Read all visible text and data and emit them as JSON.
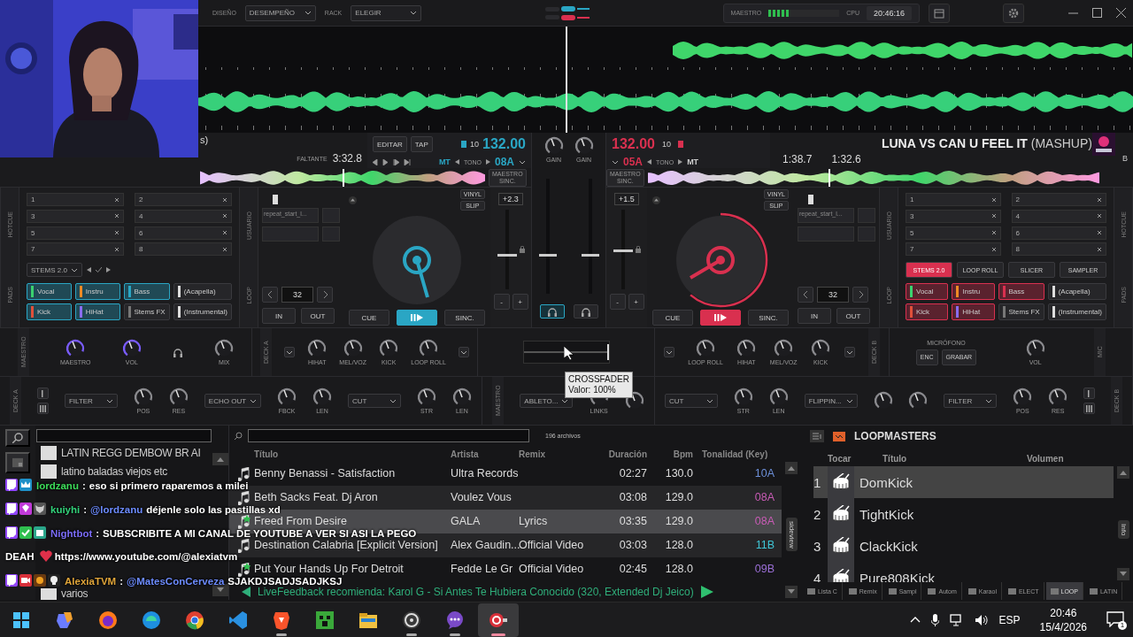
{
  "topbar": {
    "design_label": "DISEÑO",
    "design_value": "DESEMPEÑO",
    "rack_label": "RACK",
    "rack_value": "ELEGIR",
    "master_label": "MAESTRO",
    "master_meter": {
      "level": 0.3
    },
    "cpu_label": "CPU",
    "clock": "20:46:16"
  },
  "decks": [
    {
      "kind": "left",
      "color": "#2aa6c4",
      "title": "s)",
      "remaining_label": "FALTANTE",
      "remaining": "3:32.8",
      "edit": "EDITAR",
      "tap": "TAP",
      "range": "10",
      "bpm": "132.00",
      "mt": "MT",
      "tono": "TONO",
      "key": "08A",
      "sync_master": "MAESTRO",
      "sync_small": "SINC.",
      "outer_labels": [
        "HOTCUE",
        "PADS"
      ],
      "inner_labels": [
        "USUARIO",
        "LOOP"
      ],
      "hotcues": [
        "1",
        "2",
        "3",
        "4",
        "5",
        "6",
        "7",
        "8"
      ],
      "pad_page": {
        "kind": "dropdown",
        "label": "STEMS 2.0"
      },
      "pads": [
        {
          "label": "Vocal",
          "active": true,
          "color": "#3bd16f"
        },
        {
          "label": "Instru",
          "active": true,
          "color": "#f08a24"
        },
        {
          "label": "Bass",
          "active": true,
          "color": "#2aa6c4"
        },
        {
          "label": "(Acapella)",
          "active": false,
          "color": "#dddddd"
        },
        {
          "label": "Kick",
          "active": true,
          "color": "#e0503a"
        },
        {
          "label": "HiHat",
          "active": true,
          "color": "#8a6cf0"
        },
        {
          "label": "Stems FX",
          "active": false,
          "color": "#777777"
        },
        {
          "label": "(Instrumental)",
          "active": false,
          "color": "#dddddd"
        }
      ],
      "sampler_slot": "repeat_start_l...",
      "loop_length": "32",
      "loop_in": "IN",
      "loop_out": "OUT",
      "vinyl": "VINYL",
      "slip": "SLIP",
      "cue": "CUE",
      "sync": "SINC.",
      "playing": true,
      "pitch": "+2.3",
      "pitch_slider": {
        "level": 0.45
      },
      "minus": "-",
      "plus": "+"
    },
    {
      "kind": "right",
      "color": "#d9304f",
      "letter": "B",
      "title": "**LUNA VS CAN U FEEL IT** (MASHUP)",
      "elapsed": "1:38.7",
      "remaining": "1:32.6",
      "range": "10",
      "bpm": "132.00",
      "mt": "MT",
      "tono": "TONO",
      "key": "05A",
      "sync_master": "MAESTRO",
      "sync_small": "SINC.",
      "outer_labels": [
        "HOTCUE",
        "PADS"
      ],
      "inner_labels": [
        "USUARIO",
        "LOOP"
      ],
      "hotcues": [
        "1",
        "2",
        "3",
        "4",
        "5",
        "6",
        "7",
        "8"
      ],
      "pad_page": {
        "kind": "tabs",
        "tabs": [
          {
            "label": "STEMS 2.0",
            "selected": true
          },
          {
            "label": "LOOP ROLL",
            "selected": false
          },
          {
            "label": "SLICER",
            "selected": false
          },
          {
            "label": "SAMPLER",
            "selected": false
          }
        ]
      },
      "pads": [
        {
          "label": "Vocal",
          "active": true,
          "color": "#3bd16f"
        },
        {
          "label": "Instru",
          "active": true,
          "color": "#f08a24"
        },
        {
          "label": "Bass",
          "active": true,
          "color": "#d9304f"
        },
        {
          "label": "(Acapella)",
          "active": false,
          "color": "#dddddd"
        },
        {
          "label": "Kick",
          "active": true,
          "color": "#e0503a"
        },
        {
          "label": "HiHat",
          "active": true,
          "color": "#8a6cf0"
        },
        {
          "label": "Stems FX",
          "active": false,
          "color": "#777777"
        },
        {
          "label": "(Instrumental)",
          "active": false,
          "color": "#dddddd"
        }
      ],
      "sampler_slot": "repeat_start_l...",
      "loop_length": "32",
      "loop_in": "IN",
      "loop_out": "OUT",
      "vinyl": "VINYL",
      "slip": "SLIP",
      "cue": "CUE",
      "sync": "SINC.",
      "playing": true,
      "pitch": "+1.5",
      "pitch_slider": {
        "level": 0.5
      },
      "minus": "-",
      "plus": "+"
    }
  ],
  "mixer": {
    "channels": [
      {
        "gain_label": "GAIN",
        "fader": {
          "level": 0.35
        },
        "pfl": true
      },
      {
        "gain_label": "GAIN",
        "fader": {
          "level": 0.35
        },
        "pfl": false
      }
    ]
  },
  "fx": {
    "top_strip": [
      [
        {
          "kind": "vlabel",
          "text": "MAESTRO"
        },
        {
          "kind": "knob",
          "label": "MAESTRO",
          "accent": true
        },
        {
          "kind": "knob",
          "label": "VOL",
          "accent": true
        },
        {
          "kind": "headphones"
        },
        {
          "kind": "knob",
          "label": "MIX",
          "accent": false
        }
      ],
      [
        {
          "kind": "vlabel",
          "text": "DECK A"
        },
        {
          "kind": "dropdown"
        },
        {
          "kind": "knob",
          "label": "HIHAT",
          "accent": false
        },
        {
          "kind": "knob",
          "label": "MEL/VOZ",
          "accent": false
        },
        {
          "kind": "knob",
          "label": "KICK",
          "accent": false
        },
        {
          "kind": "knob",
          "label": "LOOP ROLL",
          "accent": false
        },
        {
          "kind": "dropdown"
        }
      ],
      [
        {
          "kind": "crossfader",
          "level": 1
        }
      ],
      [
        {
          "kind": "dropdown"
        },
        {
          "kind": "knob",
          "label": "LOOP ROLL",
          "accent": false
        },
        {
          "kind": "knob",
          "label": "HIHAT",
          "accent": false
        },
        {
          "kind": "knob",
          "label": "MEL/VOZ",
          "accent": false
        },
        {
          "kind": "knob",
          "label": "KICK",
          "accent": false
        },
        {
          "kind": "dropdown"
        },
        {
          "kind": "vlabel",
          "text": "DECK B"
        }
      ],
      [
        {
          "kind": "mic",
          "heading": "MICRÓFONO",
          "buttons": [
            "ENC",
            "GRABAR"
          ]
        },
        {
          "kind": "knob",
          "label": "VOL",
          "accent": false
        },
        {
          "kind": "vlabel",
          "text": "MIC"
        }
      ]
    ],
    "bottom_strip": [
      [
        {
          "kind": "vlabel",
          "text": "DECK A"
        },
        {
          "kind": "modes"
        },
        {
          "kind": "dropdown",
          "label": "FILTER"
        },
        {
          "kind": "knob",
          "label": "POS",
          "accent": false
        },
        {
          "kind": "knob",
          "label": "RES",
          "accent": false
        },
        {
          "kind": "dropdown",
          "label": "ECHO OUT"
        },
        {
          "kind": "knob",
          "label": "FBCK",
          "accent": false
        },
        {
          "kind": "knob",
          "label": "LEN",
          "accent": false
        },
        {
          "kind": "dropdown",
          "label": "CUT"
        },
        {
          "kind": "knob",
          "label": "STR",
          "accent": false
        },
        {
          "kind": "knob",
          "label": "LEN",
          "accent": false
        }
      ],
      [
        {
          "kind": "vlabel",
          "text": "MAESTRO"
        },
        {
          "kind": "dropdown",
          "label": "ABLETO..."
        },
        {
          "kind": "knob",
          "label": "LINKS",
          "accent": false
        },
        {
          "kind": "knob",
          "accent": false
        }
      ],
      [
        {
          "kind": "dropdown",
          "label": "CUT"
        },
        {
          "kind": "knob",
          "label": "STR",
          "accent": false
        },
        {
          "kind": "knob",
          "label": "LEN",
          "accent": false
        },
        {
          "kind": "dropdown",
          "label": "FLIPPIN..."
        },
        {
          "kind": "knob",
          "accent": false
        },
        {
          "kind": "knob",
          "accent": false
        },
        {
          "kind": "dropdown",
          "label": "FILTER"
        },
        {
          "kind": "knob",
          "label": "POS",
          "accent": false
        },
        {
          "kind": "knob",
          "label": "RES",
          "accent": false
        },
        {
          "kind": "modes"
        },
        {
          "kind": "vlabel",
          "text": "DECK B"
        }
      ]
    ],
    "tooltip": {
      "title": "CROSSFADER",
      "value": "Valor: 100%"
    }
  },
  "browser": {
    "folders": [
      "LATIN REGG DEMBOW BR AI",
      "latino baladas viejos etc"
    ],
    "folders_bottom": [
      "varios"
    ],
    "file_count": "196 archivos",
    "columns": [
      "Título",
      "Artista",
      "Remix",
      "Duración",
      "Bpm",
      "Tonalidad (Key)"
    ],
    "tracks": [
      {
        "title": "Benny Benassi - Satisfaction",
        "artist": "Ultra Records",
        "duration": "02:27",
        "bpm": "130.0",
        "key": "10A",
        "color": "#6c8fd8",
        "starred": false,
        "selected": false
      },
      {
        "title": "Beth Sacks Feat. Dj Aron",
        "artist": "Voulez Vous",
        "duration": "03:08",
        "bpm": "129.0",
        "key": "08A",
        "color": "#c85bb5",
        "starred": false,
        "selected": false
      },
      {
        "title": "Freed From Desire",
        "artist": "GALA",
        "remix": "Lyrics",
        "duration": "03:35",
        "bpm": "129.0",
        "key": "08A",
        "color": "#c85bb5",
        "starred": true,
        "selected": true
      },
      {
        "title": "Destination Calabria [Explicit Version]",
        "artist": "Alex Gaudin...",
        "remix": "Official Video",
        "duration": "03:03",
        "bpm": "128.0",
        "key": "11B",
        "color": "#3fc6d6",
        "starred": false,
        "selected": false
      },
      {
        "title": "Put Your Hands Up For Detroit",
        "artist": "Fedde Le Gr",
        "remix": "Official Video",
        "duration": "02:45",
        "bpm": "128.0",
        "key": "09B",
        "color": "#9b6fd6",
        "starred": true,
        "selected": false
      }
    ],
    "sideview": "sideview",
    "livefeedback": "LiveFeedback recomienda: Karol G - Si Antes Te Hubiera Conocido (320, Extended Dj Jeico)",
    "sampler": {
      "title": "LOOPMASTERS",
      "columns": [
        "Tocar",
        "Título",
        "Volumen"
      ],
      "rows": [
        {
          "number": "1",
          "name": "DomKick",
          "selected": true
        },
        {
          "number": "2",
          "name": "TightKick",
          "selected": false
        },
        {
          "number": "3",
          "name": "ClackKick",
          "selected": false
        },
        {
          "number": "4",
          "name": "Pure808Kick",
          "selected": false
        }
      ],
      "info": "Info",
      "tabs": [
        {
          "label": "Lista C",
          "selected": false
        },
        {
          "label": "Remix",
          "selected": false
        },
        {
          "label": "Sampl",
          "selected": false
        },
        {
          "label": "Autom",
          "selected": false
        },
        {
          "label": "Karaol",
          "selected": false
        },
        {
          "label": "ELECT",
          "selected": false
        },
        {
          "label": "LOOP",
          "selected": true
        },
        {
          "label": "LATIN",
          "selected": false
        }
      ]
    }
  },
  "chat": [
    {
      "badges": [
        {
          "kind": "sub"
        },
        {
          "kind": "crown"
        }
      ],
      "user": "lordzanu",
      "color": "#3ddc5a",
      "separator": ":",
      "message": "eso si primero raparemos a milei"
    },
    {
      "badges": [
        {
          "kind": "sub"
        },
        {
          "kind": "gem"
        },
        {
          "kind": "wolf"
        }
      ],
      "user": "kuiyhi",
      "color": "#33d17a",
      "separator": ":",
      "mention": "@lordzanu",
      "message": "déjenle solo las pastillas xd"
    },
    {
      "badges": [
        {
          "kind": "sub"
        },
        {
          "kind": "check"
        },
        {
          "kind": "robot"
        }
      ],
      "user": "Nightbot",
      "color": "#7b6cf6",
      "separator": ":",
      "message": "SUBSCRIBITE A MI CANAL DE YOUTUBE A VER SI ASI LA PEGO",
      "continuation": "DEAH",
      "heart": true,
      "link": "https://www.youtube.com/@alexiatvm"
    },
    {
      "badges": [
        {
          "kind": "sub"
        },
        {
          "kind": "camera"
        },
        {
          "kind": "flower"
        },
        {
          "kind": "skull"
        }
      ],
      "user": "AlexiaTVM",
      "color": "#e0a53a",
      "separator": ":",
      "mention": "@MatesConCerveza",
      "message": "SJAKDJSADJSADJKSJ"
    }
  ],
  "taskbar": {
    "apps": [
      {
        "kind": "start",
        "running": false,
        "active": false
      },
      {
        "kind": "assistant",
        "running": false,
        "active": false
      },
      {
        "kind": "fox",
        "running": false,
        "active": false
      },
      {
        "kind": "wave",
        "running": false,
        "active": false
      },
      {
        "kind": "chrome",
        "running": false,
        "active": false
      },
      {
        "kind": "code",
        "running": false,
        "active": false
      },
      {
        "kind": "lion",
        "running": true,
        "active": false
      },
      {
        "kind": "block",
        "running": false,
        "active": false
      },
      {
        "kind": "folder",
        "running": false,
        "active": false
      },
      {
        "kind": "aperture",
        "running": true,
        "active": false
      },
      {
        "kind": "bubble",
        "running": true,
        "active": false
      },
      {
        "kind": "record",
        "running": true,
        "active": true
      }
    ],
    "language": "ESP",
    "time": "20:46",
    "date": "15/4/2026",
    "notifications": "1"
  }
}
